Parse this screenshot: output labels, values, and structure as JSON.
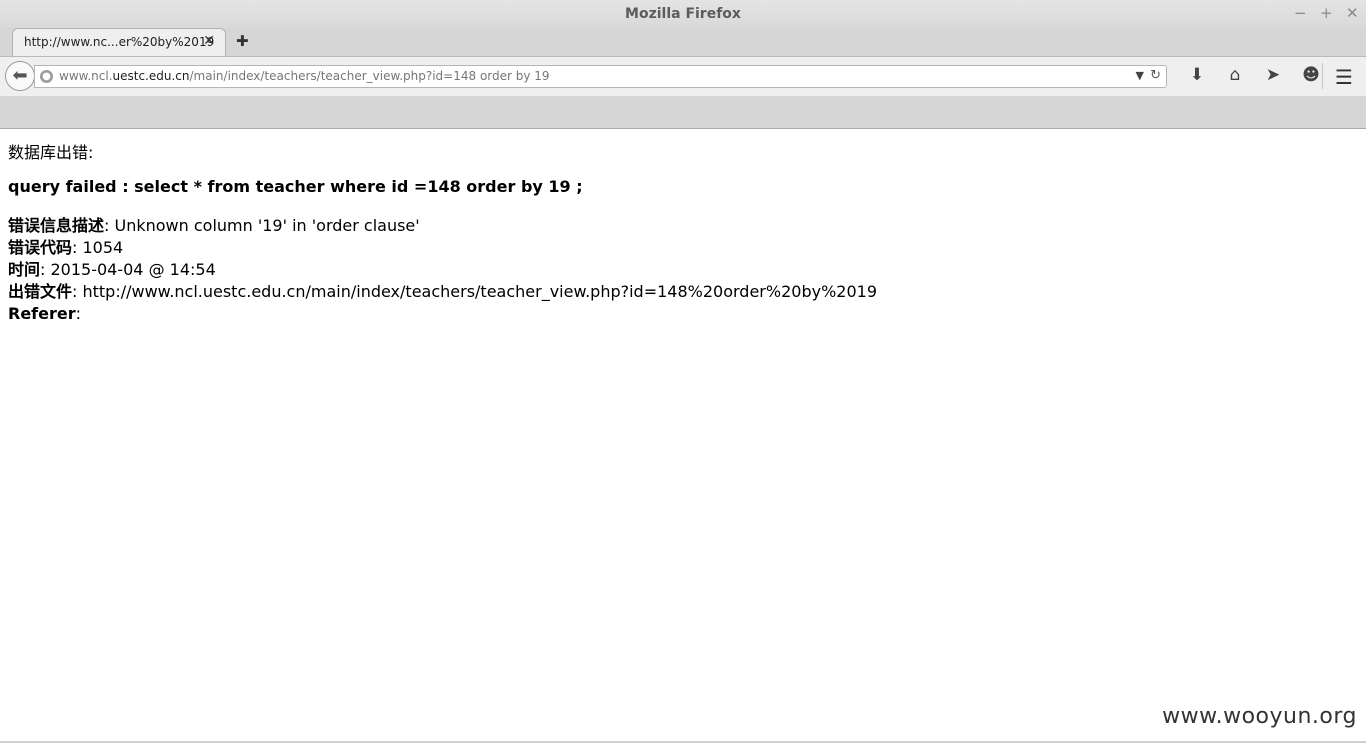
{
  "window": {
    "title": "Mozilla Firefox",
    "controls": {
      "minimize": "−",
      "maximize": "+",
      "close": "✕"
    }
  },
  "tabs": [
    {
      "label": "http://www.nc...er%20by%2019",
      "close": "✕"
    }
  ],
  "new_tab": "✚",
  "navbar": {
    "back": "⬅",
    "url_prefix": "www.ncl.",
    "url_host": "uestc.edu.cn",
    "url_path": "/main/index/teachers/teacher_view.php?id=148 order by 19",
    "icons": [
      "download-icon",
      "home-icon",
      "share-icon",
      "smiley-icon",
      "menu-icon"
    ]
  },
  "page": {
    "db_error_title": "数据库出错:",
    "query_failed": "query failed : select * from teacher where id =148 order by 19 ;",
    "fields": [
      {
        "label": "错误信息描述",
        "value": ": Unknown column '19' in 'order clause'"
      },
      {
        "label": "错误代码",
        "value": ": 1054"
      },
      {
        "label": "时间",
        "value": ": 2015-04-04 @ 14:54"
      },
      {
        "label": "出错文件",
        "value": ": http://www.ncl.uestc.edu.cn/main/index/teachers/teacher_view.php?id=148%20order%20by%2019"
      },
      {
        "label": "Referer",
        "value": ":"
      }
    ],
    "watermark": "www.wooyun.org"
  }
}
